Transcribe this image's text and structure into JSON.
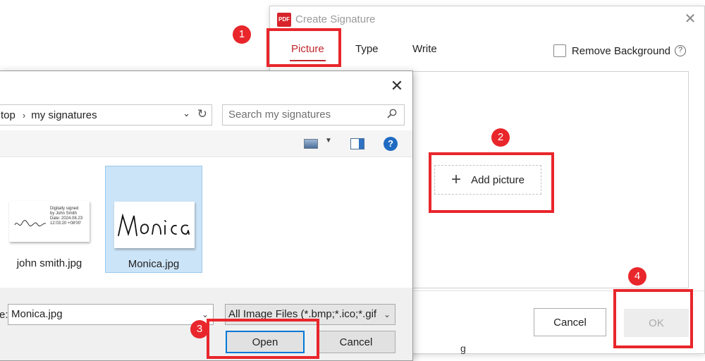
{
  "sig_dialog": {
    "app_logo_text": "PDF",
    "title": "Create Signature",
    "close_glyph": "✕",
    "tabs": [
      {
        "label": "Picture",
        "active": true
      },
      {
        "label": "Type",
        "active": false
      },
      {
        "label": "Write",
        "active": false
      }
    ],
    "remove_background": {
      "label": "Remove Background",
      "checked": false,
      "help_glyph": "?"
    },
    "add_picture": {
      "plus": "+",
      "label": "Add picture"
    },
    "cancel_label": "Cancel",
    "ok_label": "OK",
    "stray_text": "g"
  },
  "file_dialog": {
    "close_glyph": "✕",
    "breadcrumb": {
      "prefix": "top",
      "separator": "›",
      "folder": "my signatures"
    },
    "search_placeholder": "Search my signatures",
    "files": [
      {
        "name": "john smith.jpg",
        "selected": false,
        "thumb_text": [
          "Digitally signed",
          "by John Smith",
          "Date: 2024.08.23",
          "12:03:20 +08'00'"
        ],
        "sig_script": "John Smith"
      },
      {
        "name": "Monica.jpg",
        "selected": true,
        "sig_script": "Monica"
      }
    ],
    "filename_label": "e:",
    "filename_value": "Monica.jpg",
    "filter_value": "All Image Files (*.bmp;*.ico;*.gif",
    "open_label": "Open",
    "cancel_label": "Cancel"
  },
  "annotations": {
    "steps": [
      "1",
      "2",
      "3",
      "4"
    ],
    "accent_color": "#e8262b"
  },
  "colors": {
    "tab_active": "#c0272d",
    "selection": "#cce4f7",
    "primary_button_border": "#0078d7"
  },
  "icons": [
    "pdf-logo-icon",
    "close-icon",
    "plus-icon",
    "help-circle-icon",
    "chevron-down-icon",
    "refresh-icon",
    "search-icon",
    "view-icon",
    "preview-pane-icon",
    "help-icon"
  ]
}
